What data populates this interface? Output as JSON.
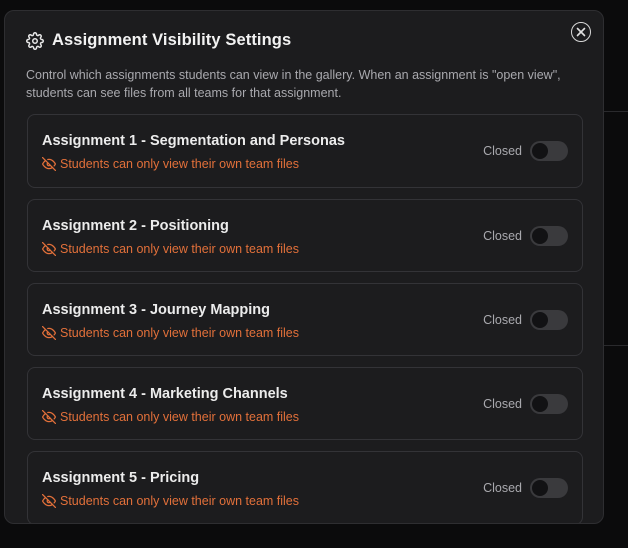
{
  "dialog": {
    "title": "Assignment Visibility Settings",
    "description": "Control which assignments students can view in the gallery. When an assignment is \"open view\", students can see files from all teams for that assignment.",
    "icons": {
      "header": "gear-icon",
      "close": "close-icon",
      "status": "eye-off-icon"
    }
  },
  "assignments": [
    {
      "title": "Assignment 1 - Segmentation and Personas",
      "status": "Students can only view their own team files",
      "state": "Closed",
      "open": false
    },
    {
      "title": "Assignment 2 - Positioning",
      "status": "Students can only view their own team files",
      "state": "Closed",
      "open": false
    },
    {
      "title": "Assignment 3 - Journey Mapping",
      "status": "Students can only view their own team files",
      "state": "Closed",
      "open": false
    },
    {
      "title": "Assignment 4 - Marketing Channels",
      "status": "Students can only view their own team files",
      "state": "Closed",
      "open": false
    },
    {
      "title": "Assignment 5 - Pricing",
      "status": "Students can only view their own team files",
      "state": "Closed",
      "open": false
    }
  ],
  "colors": {
    "background": "#1c1c1e",
    "accent_warning": "#e2703a",
    "border": "#333337"
  }
}
